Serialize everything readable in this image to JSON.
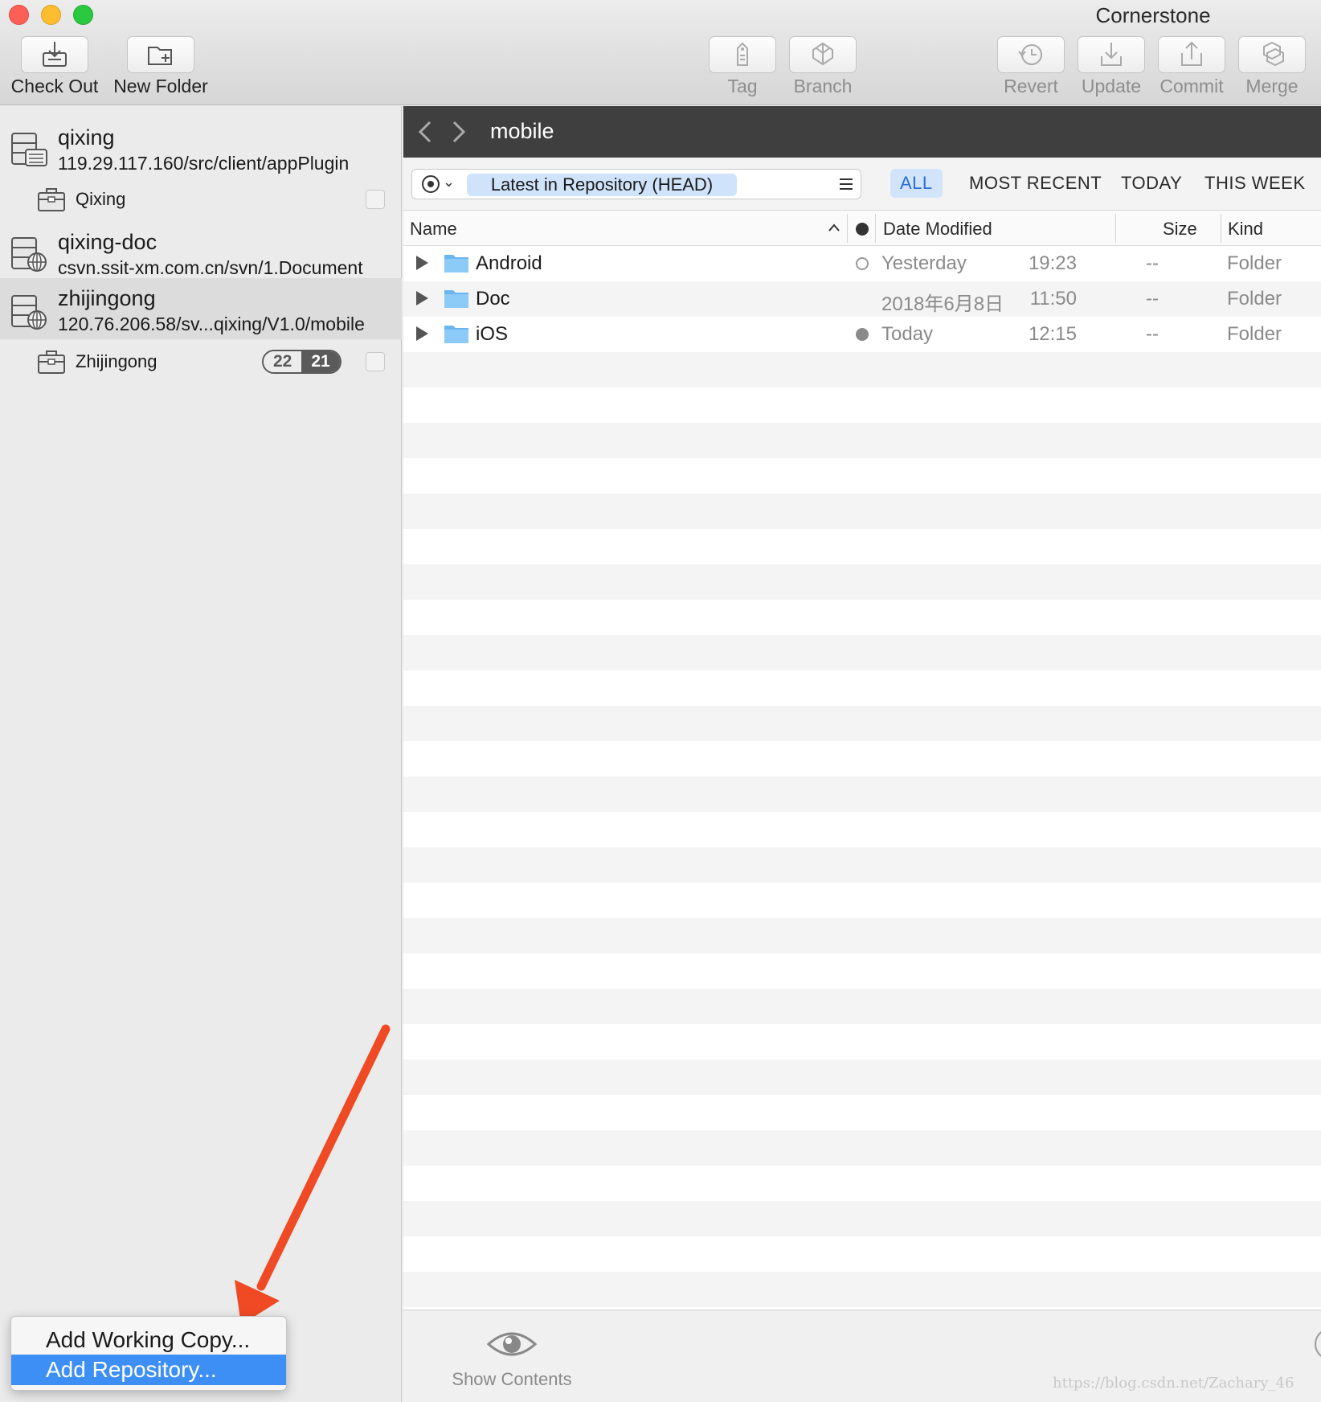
{
  "window": {
    "title": "Cornerstone"
  },
  "toolbar": {
    "check_out": "Check Out",
    "new_folder": "New Folder",
    "tag": "Tag",
    "branch": "Branch",
    "revert": "Revert",
    "update": "Update",
    "commit": "Commit",
    "merge": "Merge"
  },
  "sidebar": {
    "repos": [
      {
        "name": "qixing",
        "url": "119.29.117.160/src/client/appPlugin",
        "working_copy": "Qixing"
      },
      {
        "name": "qixing-doc",
        "url": "csvn.ssit-xm.com.cn/svn/1.Document"
      },
      {
        "name": "zhijingong",
        "url": "120.76.206.58/sv...qixing/V1.0/mobile",
        "working_copy": "Zhijingong",
        "badge_left": "22",
        "badge_right": "21"
      }
    ]
  },
  "menu": {
    "items": [
      "Add Working Copy...",
      "Add Repository..."
    ],
    "highlighted": "Add Repository..."
  },
  "browser": {
    "path": "mobile",
    "revision": "Latest in Repository (HEAD)",
    "scopes": [
      "ALL",
      "MOST RECENT",
      "TODAY",
      "THIS WEEK"
    ],
    "active_scope": "ALL",
    "columns": {
      "name": "Name",
      "date": "Date Modified",
      "size": "Size",
      "kind": "Kind"
    },
    "rows": [
      {
        "name": "Android",
        "status": "outline",
        "date": "Yesterday",
        "time": "19:23",
        "size": "--",
        "kind": "Folder"
      },
      {
        "name": "Doc",
        "status": "none",
        "date": "2018年6月8日",
        "time": "11:50",
        "size": "--",
        "kind": "Folder"
      },
      {
        "name": "iOS",
        "status": "filled",
        "date": "Today",
        "time": "12:15",
        "size": "--",
        "kind": "Folder"
      }
    ]
  },
  "bottom": {
    "show_contents": "Show Contents"
  },
  "watermark": "https://blog.csdn.net/Zachary_46",
  "colors": {
    "accent": "#3d8ff5",
    "scope_active_bg": "#d2e4fa",
    "folder": "#6cb6f0",
    "arrow": "#f04a24"
  }
}
